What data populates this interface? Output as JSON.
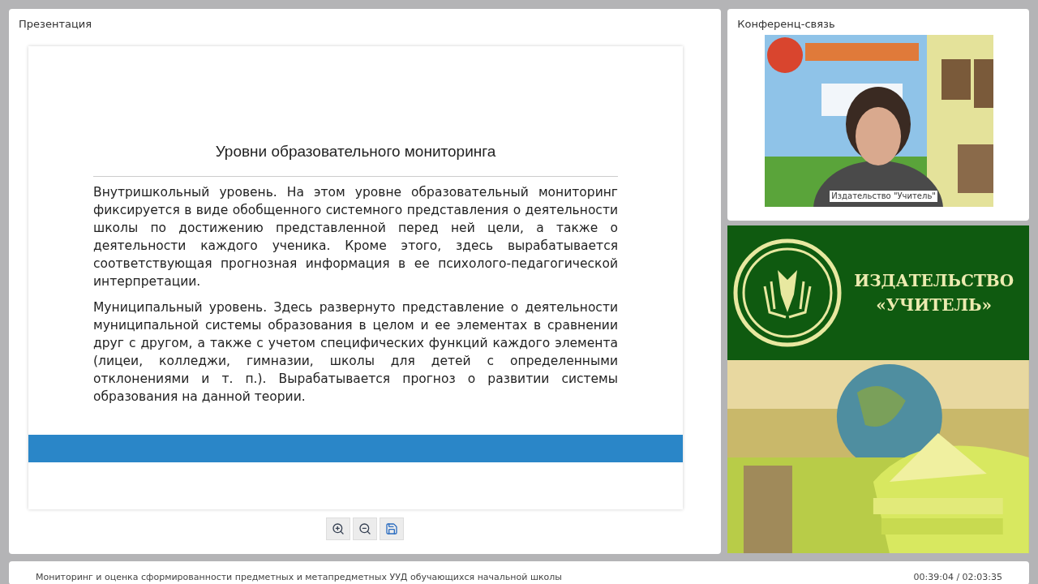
{
  "presentation_panel": {
    "title": "Презентация",
    "slide": {
      "heading": "Уровни образовательного мониторинга",
      "paragraphs": [
        "Внутришкольный уровень. На этом уровне образовательный мониторинг фиксируется в виде обобщенного системного представления о деятельности школы по достижению представленной перед ней цели, а также о деятельности каждого ученика. Кроме этого, здесь вырабатывается соответствующая прогнозная информация в ее психолого-педагогической интерпретации.",
        "Муниципальный уровень. Здесь развернуто представление о деятельности муниципальной системы образования в целом и ее элементах в сравнении друг с другом, а также с учетом специфических функций каждого элемента (лицеи, колледжи, гимназии, школы для детей с определенными отклонениями и т. п.). Вырабатывается прогноз о развитии системы образования на данной теории."
      ]
    },
    "toolbar": [
      {
        "kind": "zoom-in"
      },
      {
        "kind": "zoom-out"
      },
      {
        "kind": "save"
      }
    ]
  },
  "conference_panel": {
    "title": "Конференц-связь",
    "video": {
      "caption": "Издательство \"Учитель\""
    }
  },
  "banner": {
    "lines": [
      "ИЗДАТЕЛЬСТВО",
      "«УЧИТЕЛЬ»"
    ]
  },
  "status_bar": {
    "title": "Мониторинг и оценка сформированности предметных и метапредметных УУД обучающихся начальной школы",
    "time": "00:39:04 / 02:03:35"
  }
}
